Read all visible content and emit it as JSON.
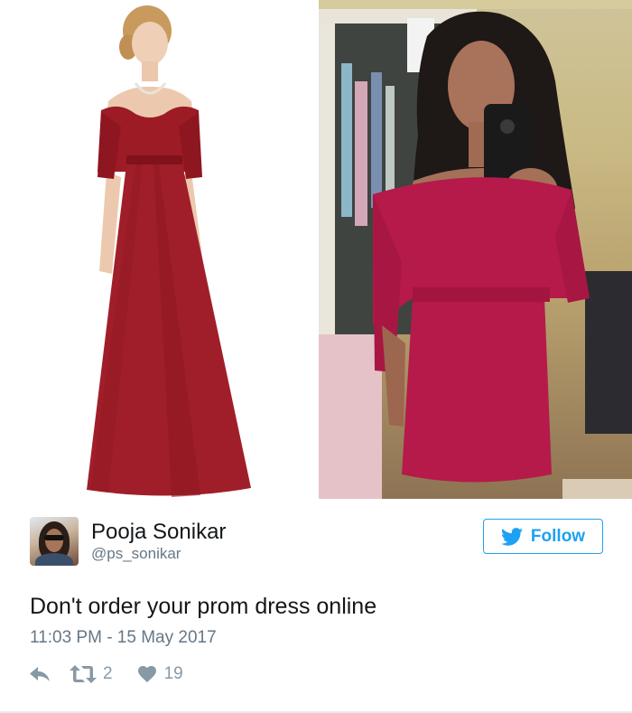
{
  "photos": {
    "left": {
      "subject": "model-in-red-off-shoulder-gown",
      "colors": {
        "dress": "#9d1b25",
        "background": "#ffffff"
      }
    },
    "right": {
      "subject": "mirror-selfie-in-pink-dress",
      "colors": {
        "dress": "#b51a4a",
        "background": "#c8b786"
      }
    }
  },
  "tweet": {
    "author": {
      "display_name": "Pooja Sonikar",
      "handle": "@ps_sonikar",
      "avatar_icon": "profile-photo"
    },
    "follow_button": {
      "label": "Follow",
      "icon": "twitter-bird-icon",
      "color": "#1da1f2"
    },
    "text": "Don't order your prom dress online",
    "timestamp": "11:03 PM - 15 May 2017",
    "actions": {
      "reply": {
        "icon": "reply-icon"
      },
      "retweet": {
        "icon": "retweet-icon",
        "count": "2"
      },
      "like": {
        "icon": "heart-icon",
        "count": "19"
      }
    }
  },
  "colors": {
    "text": "#14171a",
    "muted": "#657786",
    "action": "#8899a6",
    "accent": "#1da1f2"
  }
}
